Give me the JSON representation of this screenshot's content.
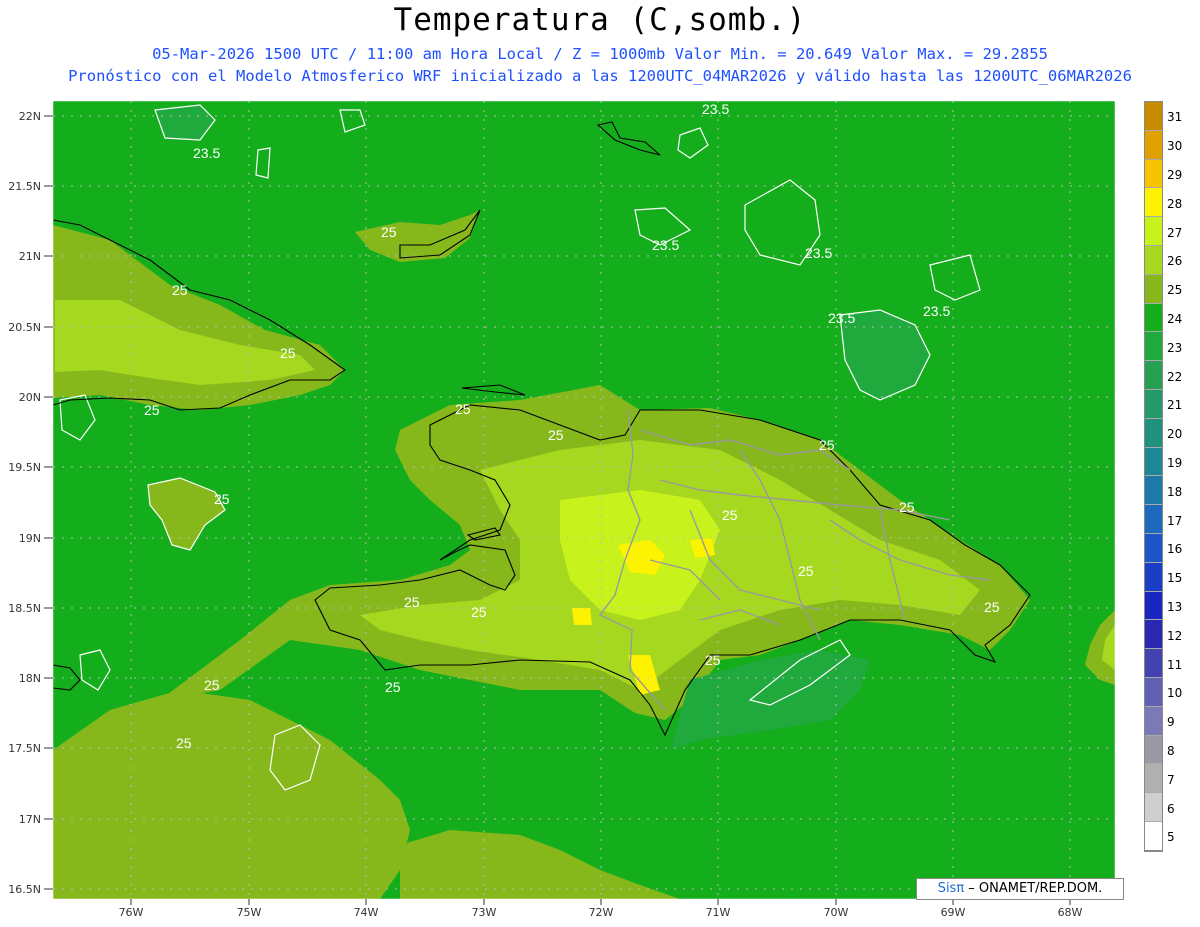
{
  "header": {
    "title": "Temperatura (C,somb.)",
    "line1": "05-Mar-2026 1500 UTC / 11:00 am Hora Local / Z = 1000mb   Valor Min. = 20.649  Valor Max. = 29.2855",
    "line2": "Pronóstico con el Modelo Atmosferico WRF inicializado a las 1200UTC_04MAR2026 y válido hasta las  1200UTC_06MAR2026"
  },
  "map": {
    "lat_labels": [
      "22N",
      "21.5N",
      "21N",
      "20.5N",
      "20N",
      "19.5N",
      "19N",
      "18.5N",
      "18N",
      "17.5N",
      "17N",
      "16.5N"
    ],
    "lon_labels": [
      "76W",
      "75W",
      "74W",
      "73W",
      "72W",
      "71W",
      "70W",
      "69W",
      "68W"
    ],
    "background_color": "#14ad1c",
    "contour_labels": [
      "23.5",
      "23.5",
      "23.5",
      "23.5",
      "23.5",
      "23.5",
      "25",
      "25",
      "25",
      "25",
      "25",
      "25",
      "25",
      "25",
      "25",
      "25",
      "25",
      "25",
      "25",
      "25",
      "25",
      "25",
      "25",
      "25"
    ]
  },
  "colorbar": {
    "labels": [
      "31",
      "30",
      "29",
      "28",
      "27",
      "26",
      "25",
      "24",
      "23",
      "22",
      "21",
      "20",
      "19",
      "18",
      "17",
      "16",
      "15",
      "13",
      "12",
      "11",
      "10",
      "9",
      "8",
      "7",
      "6",
      "5"
    ],
    "colors": [
      "#c98a00",
      "#e0a000",
      "#f7c300",
      "#fdf300",
      "#c7f21b",
      "#a7d820",
      "#86b81c",
      "#14ad1c",
      "#20a93c",
      "#27a054",
      "#24996a",
      "#1f917d",
      "#1d8894",
      "#1c7aa8",
      "#1d69bd",
      "#1c55c6",
      "#1b3fc4",
      "#1b25bf",
      "#2828b0",
      "#4343b0",
      "#5f5fb3",
      "#7d79b6",
      "#9a99a6",
      "#b0b0b0",
      "#cfcfcf",
      "#ffffff"
    ]
  },
  "credit": {
    "brand": "Sisπ",
    "text": " – ONAMET/REP.DOM."
  }
}
